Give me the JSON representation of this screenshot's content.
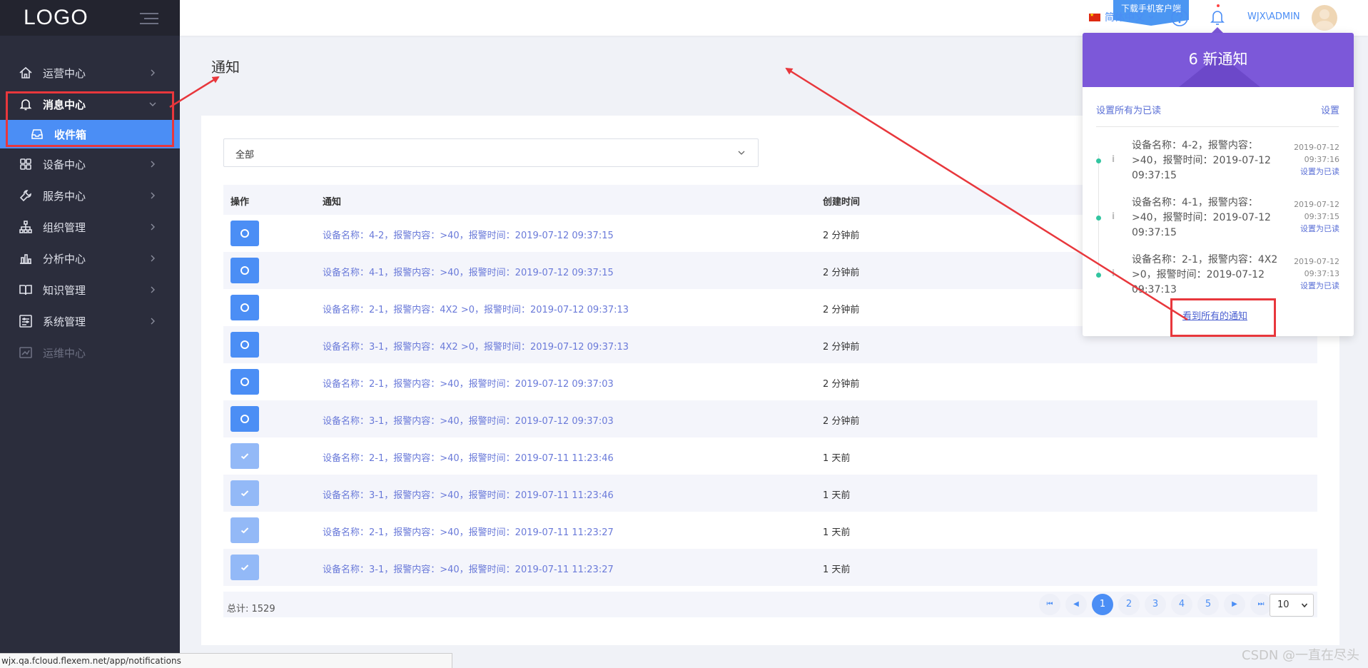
{
  "sidebar": {
    "logo": "LOGO",
    "items": [
      {
        "label": "运营中心",
        "icon": "home-icon"
      },
      {
        "label": "消息中心",
        "icon": "bell-icon",
        "open": true
      },
      {
        "label": "收件箱",
        "icon": "inbox-icon",
        "sub": true
      },
      {
        "label": "设备中心",
        "icon": "grid-icon"
      },
      {
        "label": "服务中心",
        "icon": "wrench-icon"
      },
      {
        "label": "组织管理",
        "icon": "org-chart-icon"
      },
      {
        "label": "分析中心",
        "icon": "bar-chart-icon"
      },
      {
        "label": "知识管理",
        "icon": "book-icon"
      },
      {
        "label": "系统管理",
        "icon": "settings-panel-icon"
      },
      {
        "label": "运维中心",
        "icon": "maintenance-icon",
        "disabled": true
      }
    ]
  },
  "header": {
    "download_label": "下载手机客户端",
    "language": "简体中文",
    "username": "WJX\\ADMIN"
  },
  "page": {
    "title": "通知",
    "filter_value": "全部",
    "columns": [
      "操作",
      "通知",
      "创建时间"
    ],
    "rows": [
      {
        "status": "unread",
        "message": "设备名称：4-2，报警内容：>40，报警时间：2019-07-12 09:37:15",
        "time": "2 分钟前"
      },
      {
        "status": "unread",
        "message": "设备名称：4-1，报警内容：>40，报警时间：2019-07-12 09:37:15",
        "time": "2 分钟前"
      },
      {
        "status": "unread",
        "message": "设备名称：2-1，报警内容：4X2 >0，报警时间：2019-07-12 09:37:13",
        "time": "2 分钟前"
      },
      {
        "status": "unread",
        "message": "设备名称：3-1，报警内容：4X2 >0，报警时间：2019-07-12 09:37:13",
        "time": "2 分钟前"
      },
      {
        "status": "unread",
        "message": "设备名称：2-1，报警内容：>40，报警时间：2019-07-12 09:37:03",
        "time": "2 分钟前"
      },
      {
        "status": "unread",
        "message": "设备名称：3-1，报警内容：>40，报警时间：2019-07-12 09:37:03",
        "time": "2 分钟前"
      },
      {
        "status": "read",
        "message": "设备名称：2-1，报警内容：>40，报警时间：2019-07-11 11:23:46",
        "time": "1 天前"
      },
      {
        "status": "read",
        "message": "设备名称：3-1，报警内容：>40，报警时间：2019-07-11 11:23:46",
        "time": "1 天前"
      },
      {
        "status": "read",
        "message": "设备名称：2-1，报警内容：>40，报警时间：2019-07-11 11:23:27",
        "time": "1 天前"
      },
      {
        "status": "read",
        "message": "设备名称：3-1，报警内容：>40，报警时间：2019-07-11 11:23:27",
        "time": "1 天前"
      }
    ],
    "total_text": "总计: 1529",
    "pages": [
      "1",
      "2",
      "3",
      "4",
      "5"
    ],
    "current_page": "1",
    "page_size": "10"
  },
  "popup": {
    "title": "6 新通知",
    "mark_all_read": "设置所有为已读",
    "settings": "设置",
    "items": [
      {
        "text": "设备名称：4-2，报警内容：>40，报警时间：2019-07-12 09:37:15",
        "date": "2019-07-12",
        "time": "09:37:16",
        "action": "设置为已读"
      },
      {
        "text": "设备名称：4-1，报警内容：>40，报警时间：2019-07-12 09:37:15",
        "date": "2019-07-12",
        "time": "09:37:15",
        "action": "设置为已读"
      },
      {
        "text": "设备名称：2-1，报警内容：4X2 >0，报警时间：2019-07-12 09:37:13",
        "date": "2019-07-12",
        "time": "09:37:13",
        "action": "设置为已读"
      }
    ],
    "see_all": "看到所有的通知"
  },
  "status_bar_url": "wjx.qa.fcloud.flexem.net/app/notifications",
  "watermark": "CSDN @一直在尽头",
  "colors": {
    "sidebar_bg": "#2b2d3c",
    "accent": "#4b8ef5",
    "popup_header": "#7c58d9",
    "link": "#6a7ad9",
    "annotation": "#e8373c"
  }
}
